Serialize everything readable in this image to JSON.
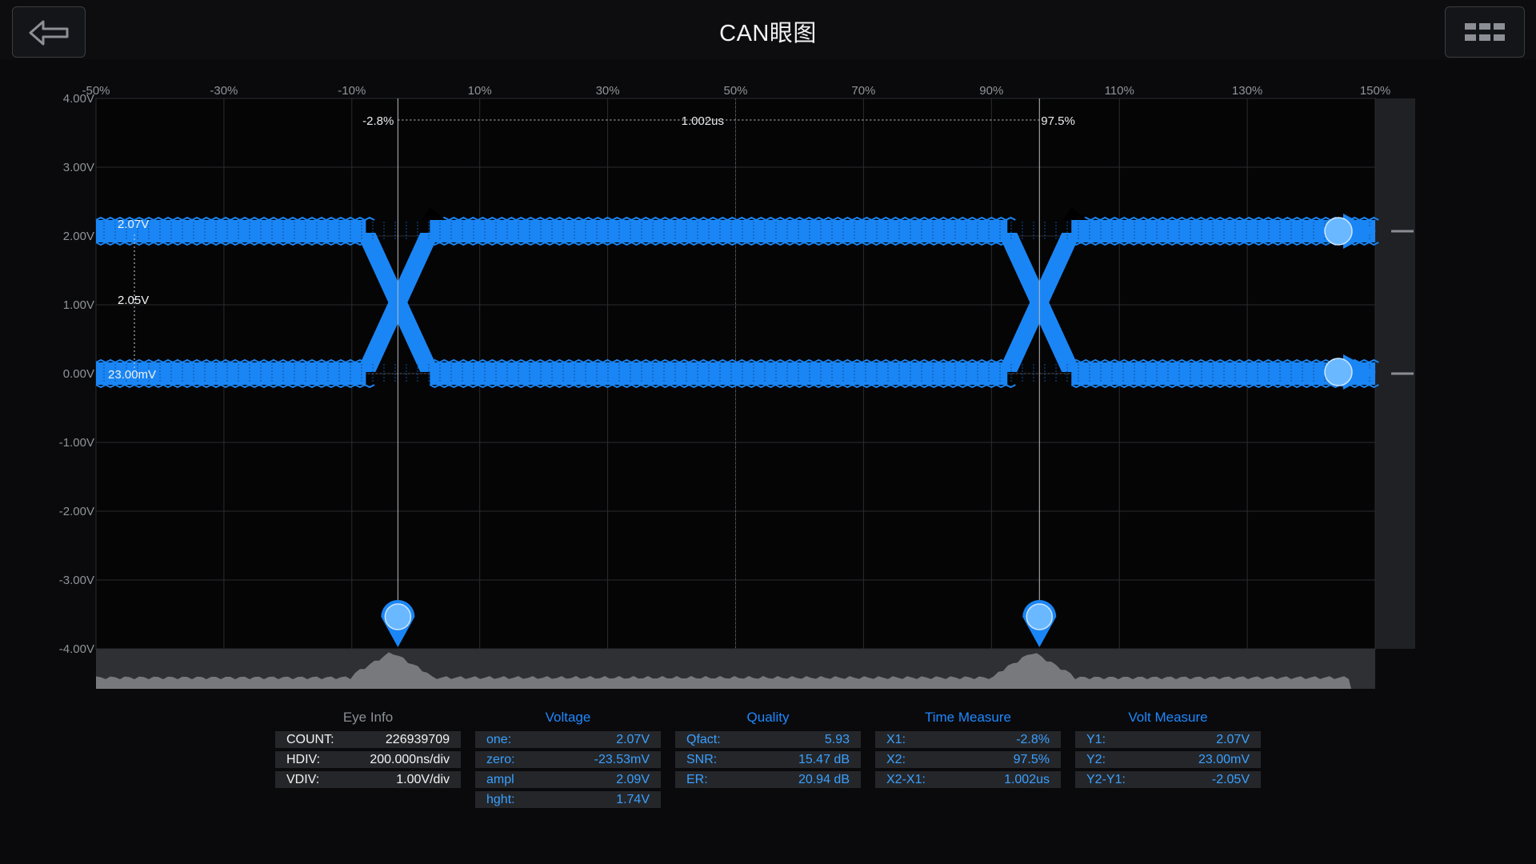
{
  "header": {
    "title": "CAN眼图"
  },
  "chart_data": {
    "type": "eye-diagram",
    "x_ticks": [
      "-50%",
      "-30%",
      "-10%",
      "10%",
      "30%",
      "50%",
      "70%",
      "90%",
      "110%",
      "130%",
      "150%"
    ],
    "y_ticks": [
      "4.00V",
      "3.00V",
      "2.00V",
      "1.00V",
      "0.00V",
      "-1.00V",
      "-2.00V",
      "-3.00V",
      "-4.00V"
    ],
    "xlim": [
      -50,
      150
    ],
    "ylim": [
      -4,
      4
    ],
    "grid": true,
    "trace_color": "#1a86f5",
    "levels": {
      "high_v": 2.07,
      "low_v": 0.0
    },
    "crossings_pct": [
      -2.8,
      97.5
    ],
    "cursors": {
      "x1_label": "-2.8%",
      "x2_label": "97.5%",
      "dx_label": "1.002us",
      "x1_pct": -2.8,
      "x2_pct": 97.5,
      "y1_label": "2.07V",
      "y2_label": "23.00mV",
      "dy_label": "2.05V",
      "y1_v": 2.07,
      "y2_v": 0.023
    }
  },
  "panels": {
    "eye_info": {
      "title": "Eye Info",
      "rows": [
        {
          "k": "COUNT:",
          "v": "226939709"
        },
        {
          "k": "HDIV:",
          "v": "200.000ns/div"
        },
        {
          "k": "VDIV:",
          "v": "1.00V/div"
        }
      ]
    },
    "voltage": {
      "title": "Voltage",
      "rows": [
        {
          "k": "one:",
          "v": "2.07V"
        },
        {
          "k": "zero:",
          "v": "-23.53mV"
        },
        {
          "k": "ampl",
          "v": "2.09V"
        },
        {
          "k": "hght:",
          "v": "1.74V"
        }
      ]
    },
    "quality": {
      "title": "Quality",
      "rows": [
        {
          "k": "Qfact:",
          "v": "5.93"
        },
        {
          "k": "SNR:",
          "v": "15.47 dB"
        },
        {
          "k": "ER:",
          "v": "20.94 dB"
        }
      ]
    },
    "time_measure": {
      "title": "Time Measure",
      "rows": [
        {
          "k": "X1:",
          "v": "-2.8%"
        },
        {
          "k": "X2:",
          "v": "97.5%"
        },
        {
          "k": "X2-X1:",
          "v": "1.002us"
        }
      ]
    },
    "volt_measure": {
      "title": "Volt Measure",
      "rows": [
        {
          "k": "Y1:",
          "v": "2.07V"
        },
        {
          "k": "Y2:",
          "v": "23.00mV"
        },
        {
          "k": "Y2-Y1:",
          "v": "-2.05V"
        }
      ]
    }
  }
}
